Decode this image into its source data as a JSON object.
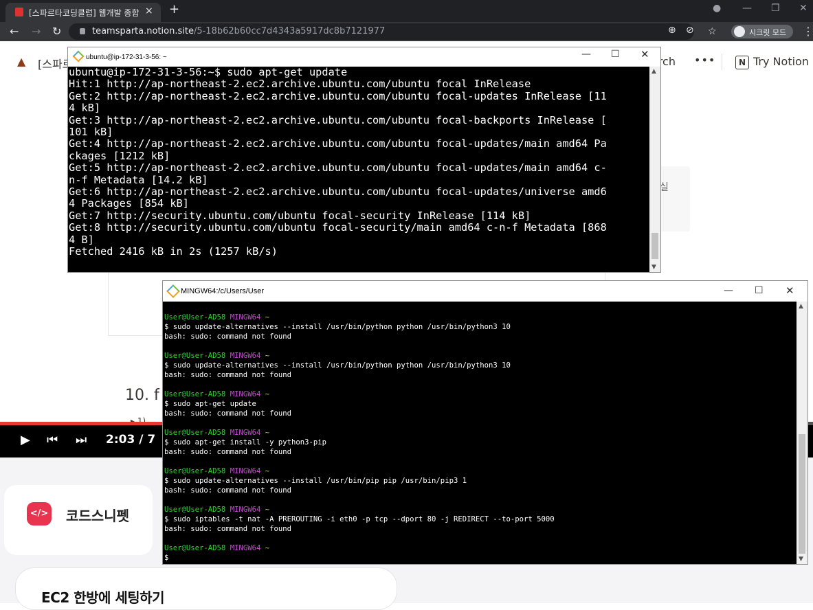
{
  "browser": {
    "tab_title": "[스파르타코딩클럽] 웹개발 종합",
    "tab_close": "×",
    "new_tab": "+",
    "url_host": "teamsparta.notion.site",
    "url_path": "/5-18b62b60cc7d4343a5917dc8b7121977",
    "incognito_label": "시크릿 모드"
  },
  "notion": {
    "page_title_fragment": "[스파르",
    "search_fragment": "arch",
    "more": "•••",
    "try_notion": "Try Notion",
    "side_fragment": "실",
    "heading_fragment": "10. f",
    "bullet_fragment": "▸ 1)"
  },
  "video": {
    "current_time": "2:03",
    "separator": "/",
    "duration_fragment": "7",
    "progress": 0.27
  },
  "snippet": {
    "icon_text": "</>",
    "label": "코드스니펫"
  },
  "ec2_title": "EC2 한방에 세팅하기",
  "ubuntu_window": {
    "title": "ubuntu@ip-172-31-3-56: ~",
    "lines": [
      "ubuntu@ip-172-31-3-56:~$ sudo apt-get update",
      "Hit:1 http://ap-northeast-2.ec2.archive.ubuntu.com/ubuntu focal InRelease",
      "Get:2 http://ap-northeast-2.ec2.archive.ubuntu.com/ubuntu focal-updates InRelease [11",
      "4 kB]",
      "Get:3 http://ap-northeast-2.ec2.archive.ubuntu.com/ubuntu focal-backports InRelease [",
      "101 kB]",
      "Get:4 http://ap-northeast-2.ec2.archive.ubuntu.com/ubuntu focal-updates/main amd64 Pa",
      "ckages [1212 kB]",
      "Get:5 http://ap-northeast-2.ec2.archive.ubuntu.com/ubuntu focal-updates/main amd64 c-",
      "n-f Metadata [14.2 kB]",
      "Get:6 http://ap-northeast-2.ec2.archive.ubuntu.com/ubuntu focal-updates/universe amd6",
      "4 Packages [854 kB]",
      "Get:7 http://security.ubuntu.com/ubuntu focal-security InRelease [114 kB]",
      "Get:8 http://security.ubuntu.com/ubuntu focal-security/main amd64 c-n-f Metadata [868",
      "4 B]",
      "Fetched 2416 kB in 2s (1257 kB/s)"
    ]
  },
  "mingw_window": {
    "title": "MINGW64:/c/Users/User",
    "prompt_user": "User@User-AD58",
    "prompt_env": "MINGW64",
    "prompt_dir": "~",
    "blocks": [
      {
        "cmd": "$ sudo update-alternatives --install /usr/bin/python python /usr/bin/python3 10",
        "out": "bash: sudo: command not found"
      },
      {
        "cmd": "$ sudo update-alternatives --install /usr/bin/python python /usr/bin/python3 10",
        "out": "bash: sudo: command not found"
      },
      {
        "cmd": "$ sudo apt-get update",
        "out": "bash: sudo: command not found"
      },
      {
        "cmd": "$ sudo apt-get install -y python3-pip",
        "out": "bash: sudo: command not found"
      },
      {
        "cmd": "$ sudo update-alternatives --install /usr/bin/pip pip /usr/bin/pip3 1",
        "out": "bash: sudo: command not found"
      },
      {
        "cmd": "$ sudo iptables -t nat -A PREROUTING -i eth0 -p tcp --dport 80 -j REDIRECT --to-port 5000",
        "out": "bash: sudo: command not found"
      }
    ],
    "final_prompt": "$"
  },
  "colors": {
    "prompt_user": "#2fd42f",
    "prompt_env": "#c64dd4",
    "prompt_dir": "#d4c22f",
    "video_progress": "#e53935",
    "snippet_icon": "#e8344e"
  }
}
